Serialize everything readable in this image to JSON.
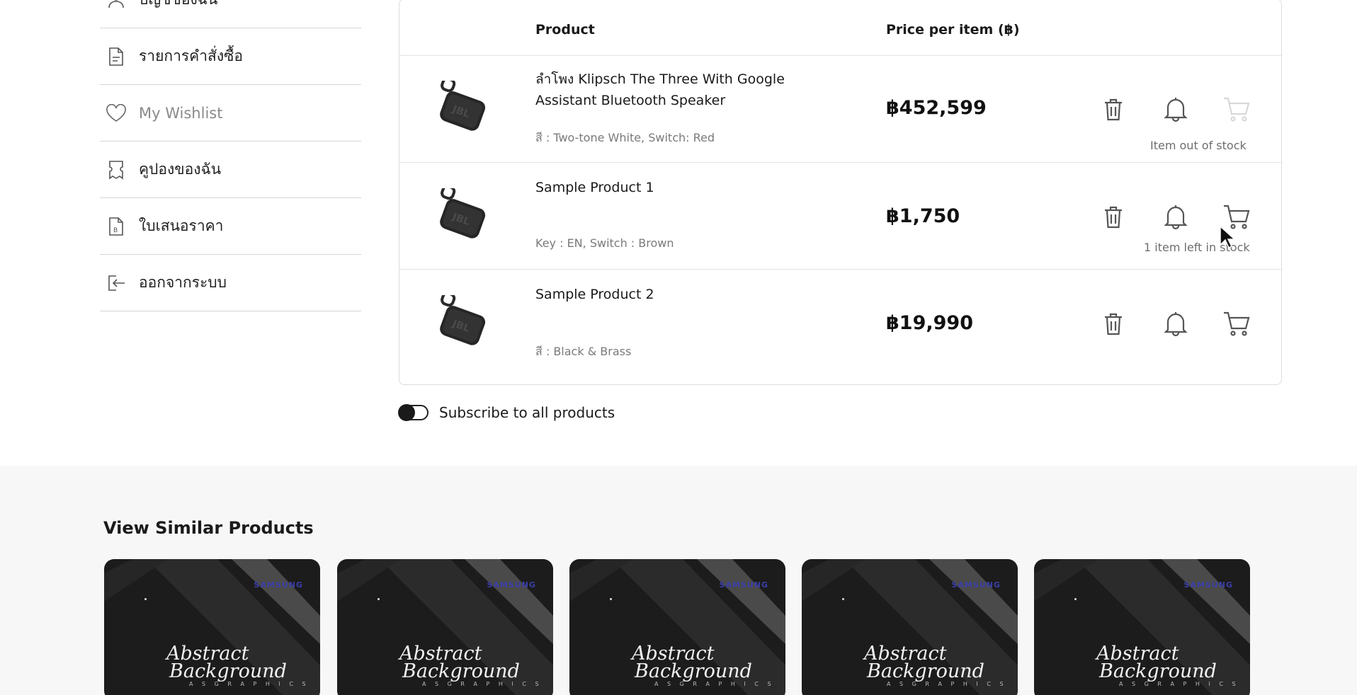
{
  "sidebar": {
    "items": [
      {
        "label": "บัญชีของฉัน",
        "icon": "user-icon"
      },
      {
        "label": "รายการคำสั่งซื้อ",
        "icon": "document-icon"
      },
      {
        "label": "My Wishlist",
        "icon": "heart-icon"
      },
      {
        "label": "คูปองของฉัน",
        "icon": "coupon-icon"
      },
      {
        "label": "ใบเสนอราคา",
        "icon": "quotation-icon"
      },
      {
        "label": "ออกจากระบบ",
        "icon": "logout-icon"
      }
    ]
  },
  "table": {
    "headers": {
      "product": "Product",
      "price": "Price per item (฿)"
    },
    "rows": [
      {
        "name": "ลำโพง Klipsch The Three With Google Assistant Bluetooth Speaker",
        "variant": "สี : Two-tone White, Switch: Red",
        "price": "฿452,599",
        "stock": "Item out of stock",
        "cart_enabled": false
      },
      {
        "name": "Sample Product 1",
        "variant": "Key : EN, Switch : Brown",
        "price": "฿1,750",
        "stock": "1 item left in stock",
        "cart_enabled": true
      },
      {
        "name": "Sample Product 2",
        "variant": "สี : Black & Brass",
        "price": "฿19,990",
        "stock": "",
        "cart_enabled": true
      }
    ]
  },
  "subscribe": {
    "label": "Subscribe to all products",
    "enabled": false
  },
  "similar": {
    "title": "View Similar Products",
    "cards": [
      {
        "brand": "SAMSUNG",
        "line1": "Abstract",
        "line2": "Background",
        "line3": "A S G R A P H I C S"
      },
      {
        "brand": "SAMSUNG",
        "line1": "Abstract",
        "line2": "Background",
        "line3": "A S G R A P H I C S"
      },
      {
        "brand": "SAMSUNG",
        "line1": "Abstract",
        "line2": "Background",
        "line3": "A S G R A P H I C S"
      },
      {
        "brand": "SAMSUNG",
        "line1": "Abstract",
        "line2": "Background",
        "line3": "A S G R A P H I C S"
      },
      {
        "brand": "SAMSUNG",
        "line1": "Abstract",
        "line2": "Background",
        "line3": "A S G R A P H I C S"
      }
    ]
  },
  "colors": {
    "accent": "#1a1a1a",
    "muted": "#7a7a7a",
    "disabled": "#d8d8d8",
    "brand": "#3a3fa8"
  }
}
